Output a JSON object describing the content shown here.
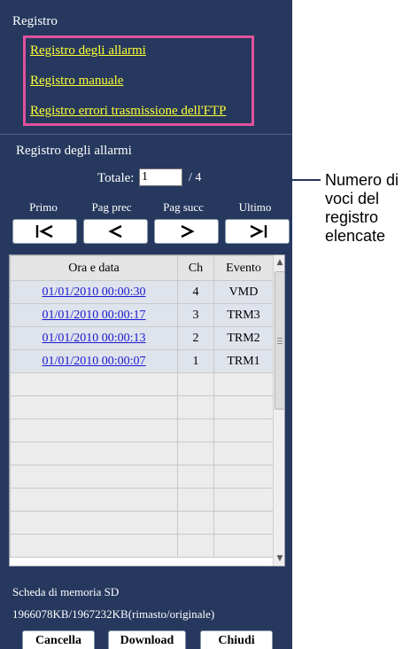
{
  "log_section": {
    "title": "Registro",
    "links": [
      "Registro degli allarmi",
      "Registro manuale",
      "Registro errori trasmissione dell'FTP"
    ]
  },
  "alarm_log": {
    "title": "Registro degli allarmi",
    "total_label": "Totale:",
    "total_value": "1",
    "total_of": "/ 4"
  },
  "callout": {
    "lines": [
      "Numero di",
      "voci del",
      "registro",
      "elencate"
    ]
  },
  "nav": {
    "first_label": "Primo",
    "prev_label": "Pag prec",
    "next_label": "Pag succ",
    "last_label": "Ultimo"
  },
  "table": {
    "headers": [
      "Ora e data",
      "Ch",
      "Evento"
    ],
    "rows": [
      {
        "datetime": "01/01/2010 00:00:30",
        "ch": "4",
        "event": "VMD"
      },
      {
        "datetime": "01/01/2010 00:00:17",
        "ch": "3",
        "event": "TRM3"
      },
      {
        "datetime": "01/01/2010 00:00:13",
        "ch": "2",
        "event": "TRM2"
      },
      {
        "datetime": "01/01/2010 00:00:07",
        "ch": "1",
        "event": "TRM1"
      }
    ]
  },
  "sd_card": {
    "title": "Scheda di memoria SD",
    "capacity": "1966078KB/1967232KB(rimasto/originale)"
  },
  "buttons": {
    "delete": "Cancella",
    "download": "Download",
    "close": "Chiudi"
  },
  "colors": {
    "panel_bg": "#26385e",
    "link_yellow": "#ffff33",
    "highlight_pink": "#e0529b",
    "date_link_blue": "#1a1ad0"
  }
}
